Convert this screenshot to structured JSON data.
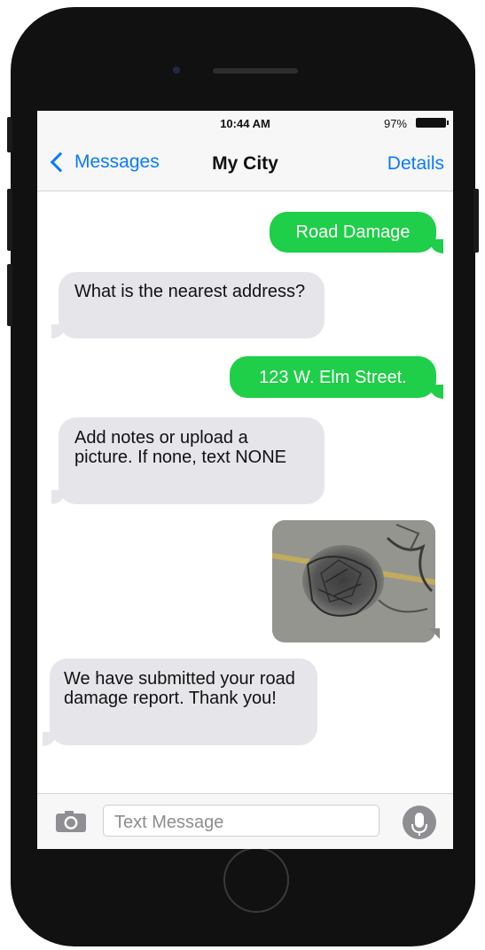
{
  "status_bar": {
    "time": "10:44 AM",
    "battery_percent": "97%"
  },
  "nav": {
    "back_label": "Messages",
    "title": "My City",
    "details_label": "Details"
  },
  "messages": [
    {
      "from": "me",
      "text": "Road Damage"
    },
    {
      "from": "them",
      "text": "What is the nearest address?"
    },
    {
      "from": "me",
      "text": "123 W. Elm Street."
    },
    {
      "from": "them",
      "text": "Add notes or upload a picture. If none, text NONE"
    },
    {
      "from": "me",
      "type": "photo"
    },
    {
      "from": "them",
      "text": "We have submitted your road damage report. Thank you!"
    }
  ],
  "composer": {
    "placeholder": "Text Message"
  },
  "icons": {
    "back": "chevron-left-icon",
    "camera": "camera-icon",
    "mic": "microphone-icon"
  },
  "colors": {
    "sent_bubble": "#1fce49",
    "received_bubble": "#e6e5ea",
    "link": "#0a7aff"
  }
}
